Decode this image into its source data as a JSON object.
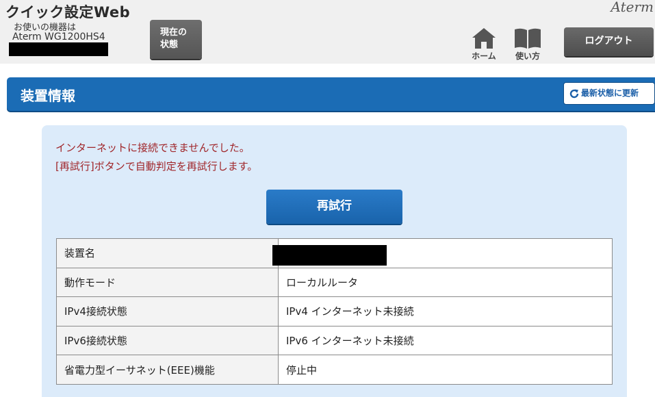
{
  "header": {
    "app_title": "クイック設定Web",
    "device_caption": "お使いの機器は",
    "device_model": "Aterm WG1200HS4",
    "brand": "Aterm",
    "status_button": [
      "現在の",
      "状態"
    ],
    "home_label": "ホーム",
    "manual_label": "使い方",
    "logout_label": "ログアウト"
  },
  "title_bar": {
    "title": "装置情報",
    "refresh_label": "最新状態に更新"
  },
  "main": {
    "message_1": "インターネットに接続できませんでした。",
    "message_2": "[再試行]ボタンで自動判定を再試行します。",
    "retry_label": "再試行",
    "rows": [
      {
        "label": "装置名",
        "value": ""
      },
      {
        "label": "動作モード",
        "value": "ローカルルータ"
      },
      {
        "label": "IPv4接続状態",
        "value": "IPv4 インターネット未接続"
      },
      {
        "label": "IPv6接続状態",
        "value": "IPv6 インターネット未接続"
      },
      {
        "label": "省電力型イーサネット(EEE)機能",
        "value": "停止中"
      }
    ]
  },
  "colors": {
    "accent_blue": "#1b6cb5",
    "error_text": "#a0262a",
    "panel_bg": "#dcebfa"
  }
}
